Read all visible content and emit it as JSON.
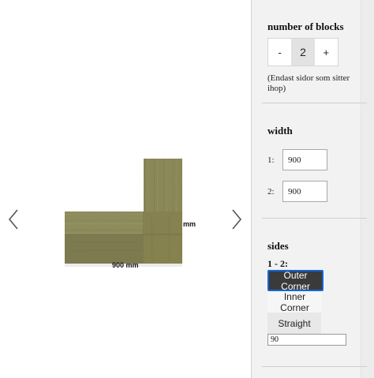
{
  "viewer": {
    "prev_icon": "chevron-left-icon",
    "next_icon": "chevron-right-icon",
    "dim_right": "mm",
    "dim_bottom": "900 mm",
    "wood_color": "#8d8a5c"
  },
  "blocks": {
    "title": "number of blocks",
    "minus_label": "-",
    "value": "2",
    "plus_label": "+",
    "note": "(Endast sidor som sitter ihop)"
  },
  "width": {
    "title": "width",
    "rows": [
      {
        "label": "1:",
        "value": "900"
      },
      {
        "label": "2:",
        "value": "900"
      }
    ]
  },
  "sides": {
    "title": "sides",
    "pair_label": "1 - 2:",
    "options": [
      {
        "label": "Outer Corner",
        "selected": true
      },
      {
        "label": "Inner Corner",
        "selected": false
      },
      {
        "label": "Straight",
        "selected": false
      }
    ],
    "angle_value": "90",
    "accent_color": "#1565d8"
  }
}
